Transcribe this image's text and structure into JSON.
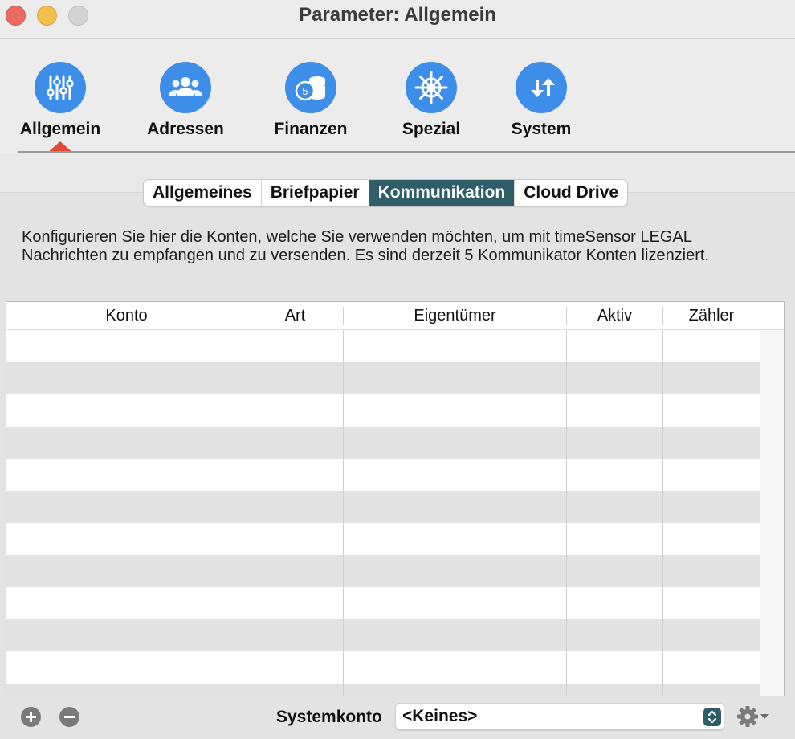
{
  "window": {
    "title": "Parameter: Allgemein"
  },
  "toolbar": {
    "items": [
      {
        "label": "Allgemein",
        "icon": "sliders-icon"
      },
      {
        "label": "Adressen",
        "icon": "people-icon"
      },
      {
        "label": "Finanzen",
        "icon": "coins-icon"
      },
      {
        "label": "Spezial",
        "icon": "wheel-icon"
      },
      {
        "label": "System",
        "icon": "arrows-icon"
      }
    ],
    "selected": "Allgemein",
    "accent": "#3d8ee8",
    "indicator_color": "#e34a33"
  },
  "tabs": {
    "items": [
      "Allgemeines",
      "Briefpapier",
      "Kommunikation",
      "Cloud Drive"
    ],
    "active": "Kommunikation",
    "active_color": "#2f5e68"
  },
  "description": "Konfigurieren Sie hier die Konten, welche Sie verwenden möchten, um mit timeSensor LEGAL Nachrichten zu empfangen und zu versenden. Es sind derzeit 5 Kommunikator Konten lizenziert.",
  "table": {
    "columns": [
      "Konto",
      "Art",
      "Eigentümer",
      "Aktiv",
      "Zähler"
    ],
    "rows": []
  },
  "footer": {
    "system_account_label": "Systemkonto",
    "system_account_value": "<Keines>"
  }
}
